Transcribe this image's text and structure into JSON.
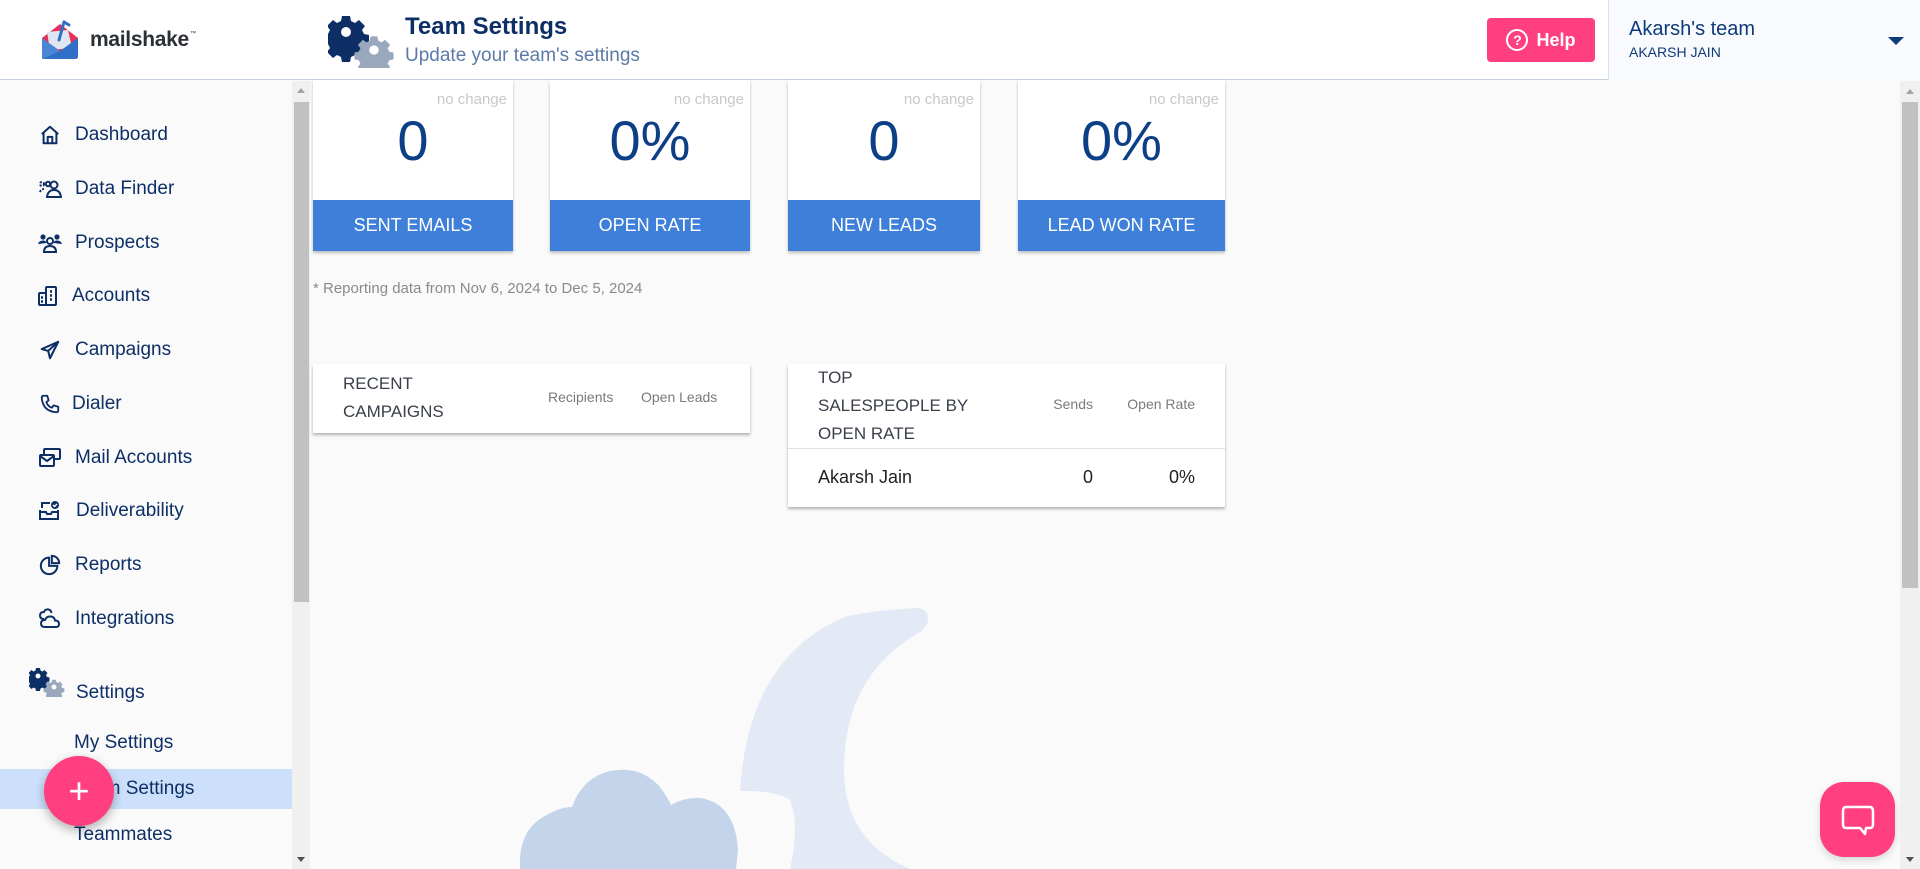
{
  "header": {
    "brand": "mailshake",
    "brand_tm": "™",
    "page_icon": "gears-icon",
    "title": "Team Settings",
    "subtitle": "Update your team's settings",
    "help_label": "Help",
    "help_icon": "?",
    "team_name": "Akarsh's team",
    "user_name": "AKARSH JAIN"
  },
  "sidebar": {
    "items": [
      {
        "label": "Dashboard",
        "icon": "home-icon"
      },
      {
        "label": "Data Finder",
        "icon": "people-search-icon"
      },
      {
        "label": "Prospects",
        "icon": "people-group-icon"
      },
      {
        "label": "Accounts",
        "icon": "building-icon"
      },
      {
        "label": "Campaigns",
        "icon": "paper-plane-icon"
      },
      {
        "label": "Dialer",
        "icon": "phone-icon"
      },
      {
        "label": "Mail Accounts",
        "icon": "mail-accounts-icon"
      },
      {
        "label": "Deliverability",
        "icon": "inbox-check-icon"
      },
      {
        "label": "Reports",
        "icon": "pie-chart-icon"
      },
      {
        "label": "Integrations",
        "icon": "cloud-icon"
      }
    ],
    "settings": {
      "label": "Settings",
      "icon": "gears-icon",
      "sub_items": [
        {
          "label": "My Settings",
          "active": false
        },
        {
          "label": "Team Settings",
          "active": true
        },
        {
          "label": "Teammates",
          "active": false
        }
      ]
    }
  },
  "stats": [
    {
      "value": "0",
      "change": "no change",
      "label": "SENT EMAILS"
    },
    {
      "value": "0%",
      "change": "no change",
      "label": "OPEN RATE"
    },
    {
      "value": "0",
      "change": "no change",
      "label": "NEW LEADS"
    },
    {
      "value": "0%",
      "change": "no change",
      "label": "LEAD WON RATE"
    }
  ],
  "reporting_note": "* Reporting data from Nov 6, 2024 to Dec 5, 2024",
  "recent_campaigns": {
    "title_line1": "RECENT",
    "title_line2": "CAMPAIGNS",
    "columns": [
      "Recipients",
      "Open Leads"
    ],
    "rows": []
  },
  "top_salespeople": {
    "title_line1": "TOP",
    "title_line2": "SALESPEOPLE BY",
    "title_line3": "OPEN RATE",
    "columns": [
      "Sends",
      "Open Rate"
    ],
    "rows": [
      {
        "name": "Akarsh Jain",
        "sends": "0",
        "open_rate": "0%"
      }
    ]
  },
  "fab_label": "+",
  "colors": {
    "accent_pink": "#ff3f7f",
    "brand_blue": "#3d7fd9",
    "navy": "#0d2f66",
    "active_bg": "#cce0fb"
  }
}
